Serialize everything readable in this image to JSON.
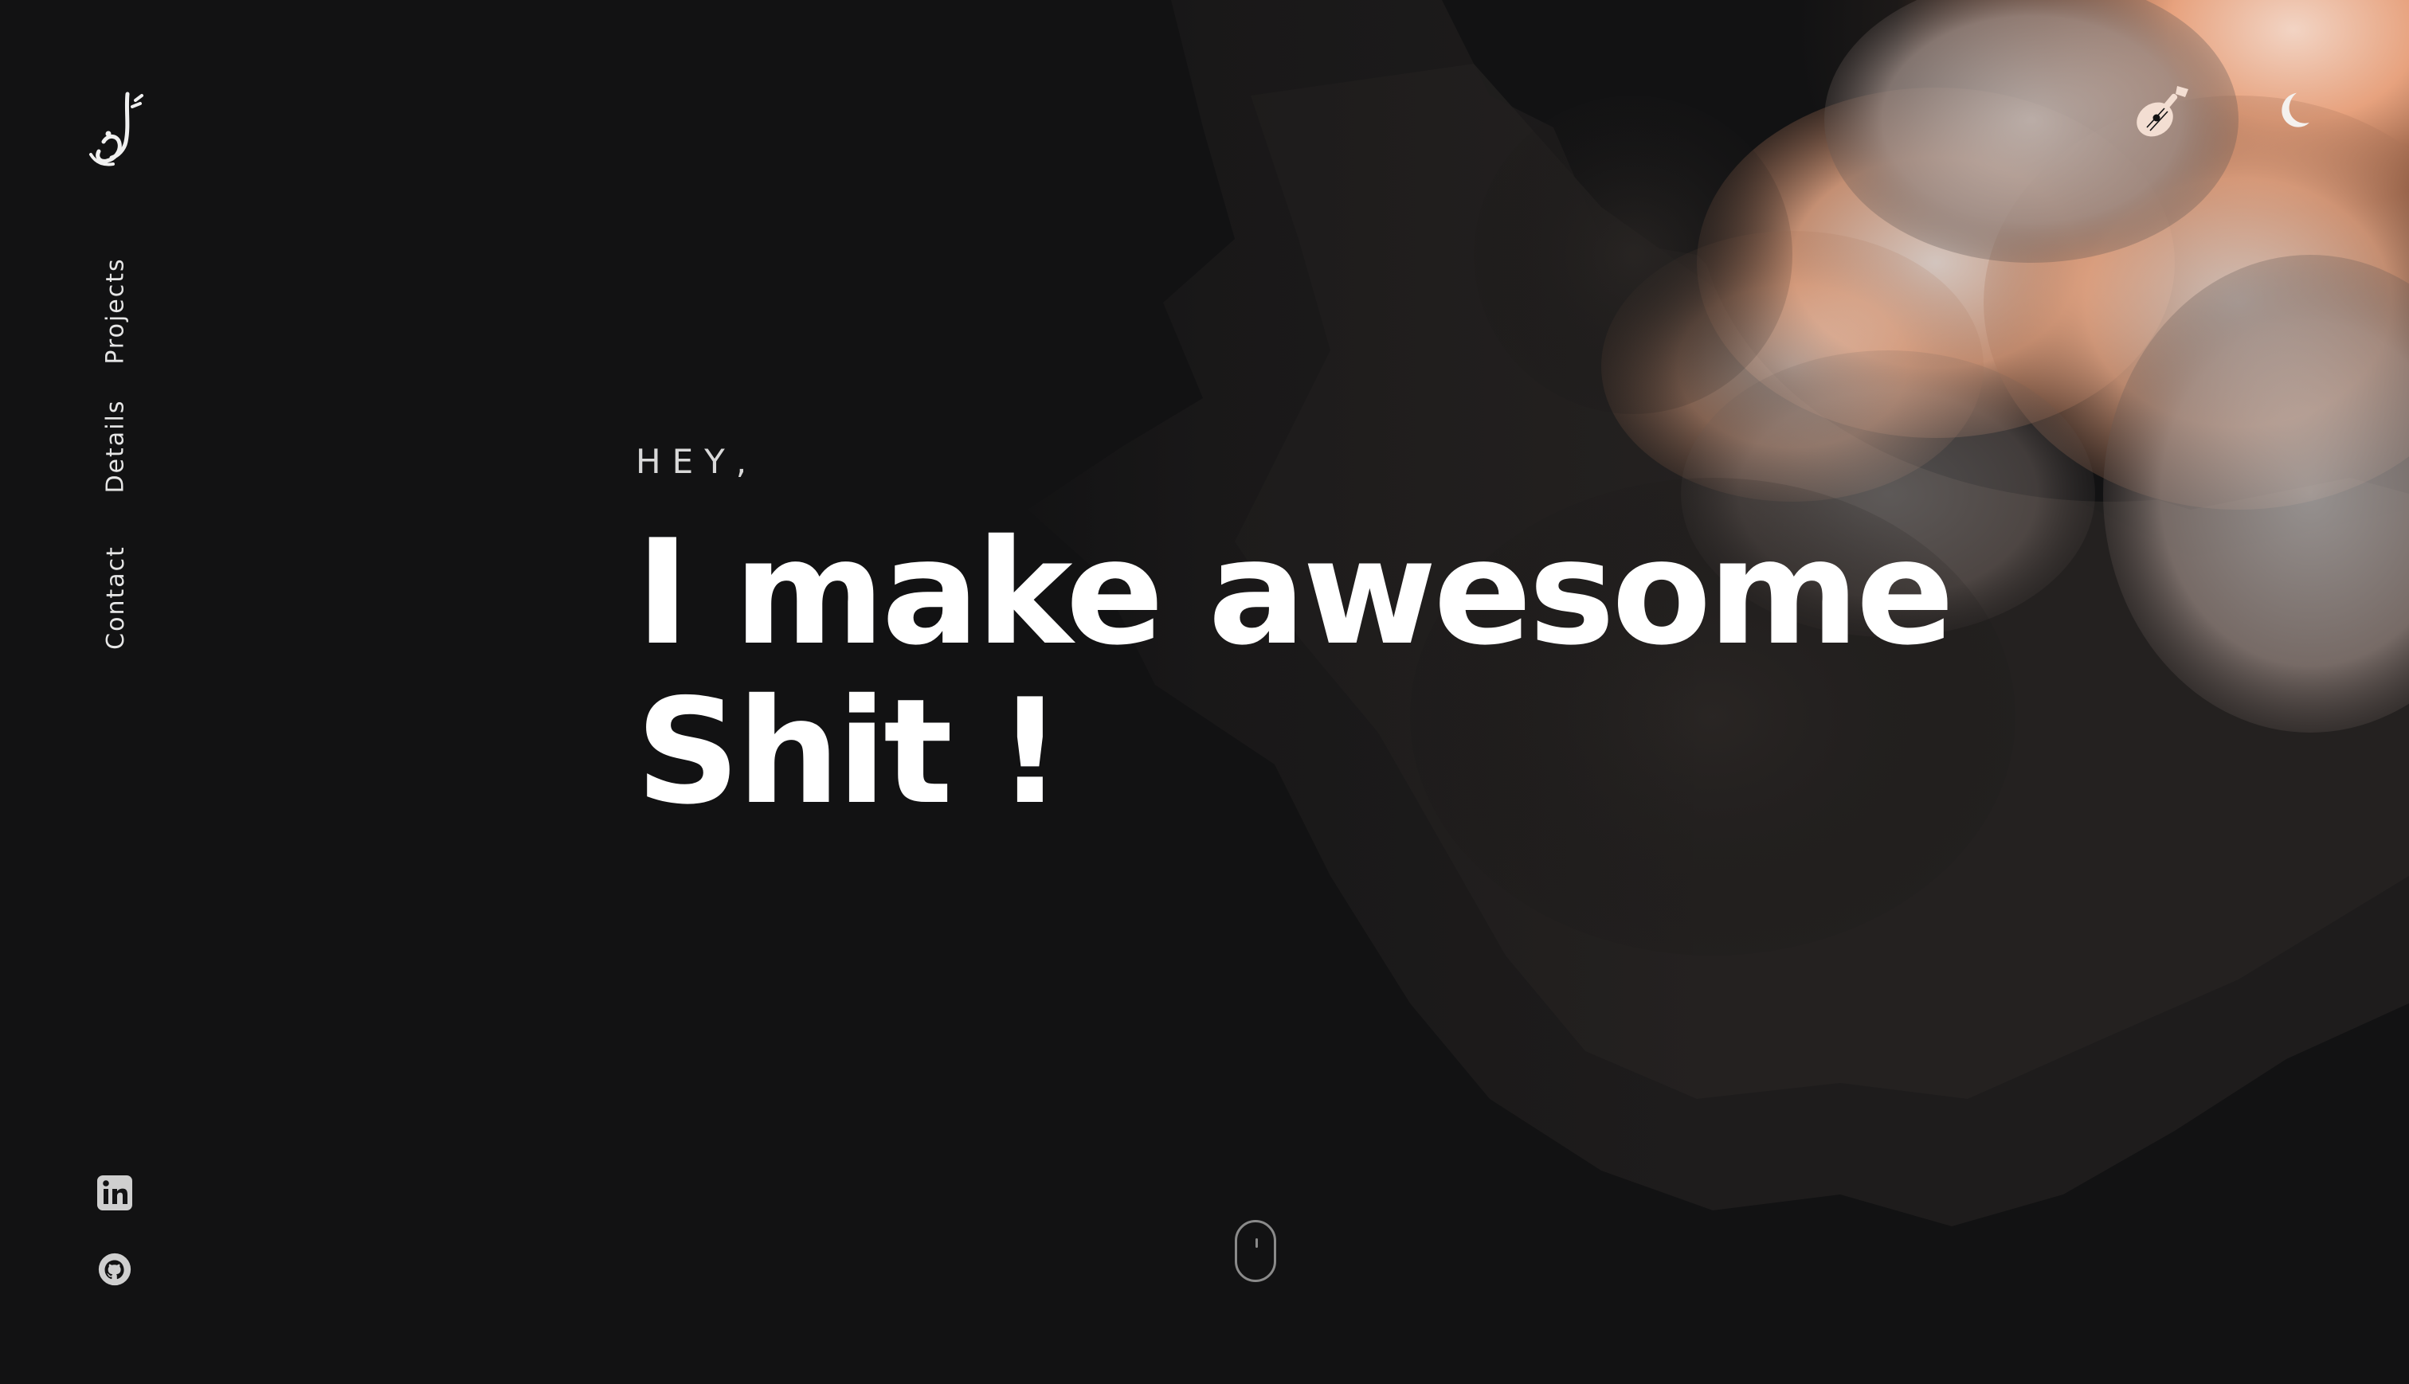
{
  "colors": {
    "background": "#121213",
    "text": "#ffffff",
    "muted": "#d9d9d9",
    "accent_peach": "#e8a888"
  },
  "logo": {
    "icon": "arabic-calligraphy-logo",
    "alt": "أحمد"
  },
  "nav": {
    "items": [
      {
        "label": "Projects"
      },
      {
        "label": "Details"
      },
      {
        "label": "Contact"
      }
    ]
  },
  "social": [
    {
      "icon": "linkedin-icon"
    },
    {
      "icon": "github-icon"
    }
  ],
  "header_actions": [
    {
      "icon": "oud-icon"
    },
    {
      "icon": "moon-icon"
    }
  ],
  "hero": {
    "greeting": "HEY,",
    "headline_line1": "I make awesome",
    "headline_line2": "Shit !"
  },
  "scroll_indicator": {
    "icon": "mouse-scroll-icon"
  }
}
